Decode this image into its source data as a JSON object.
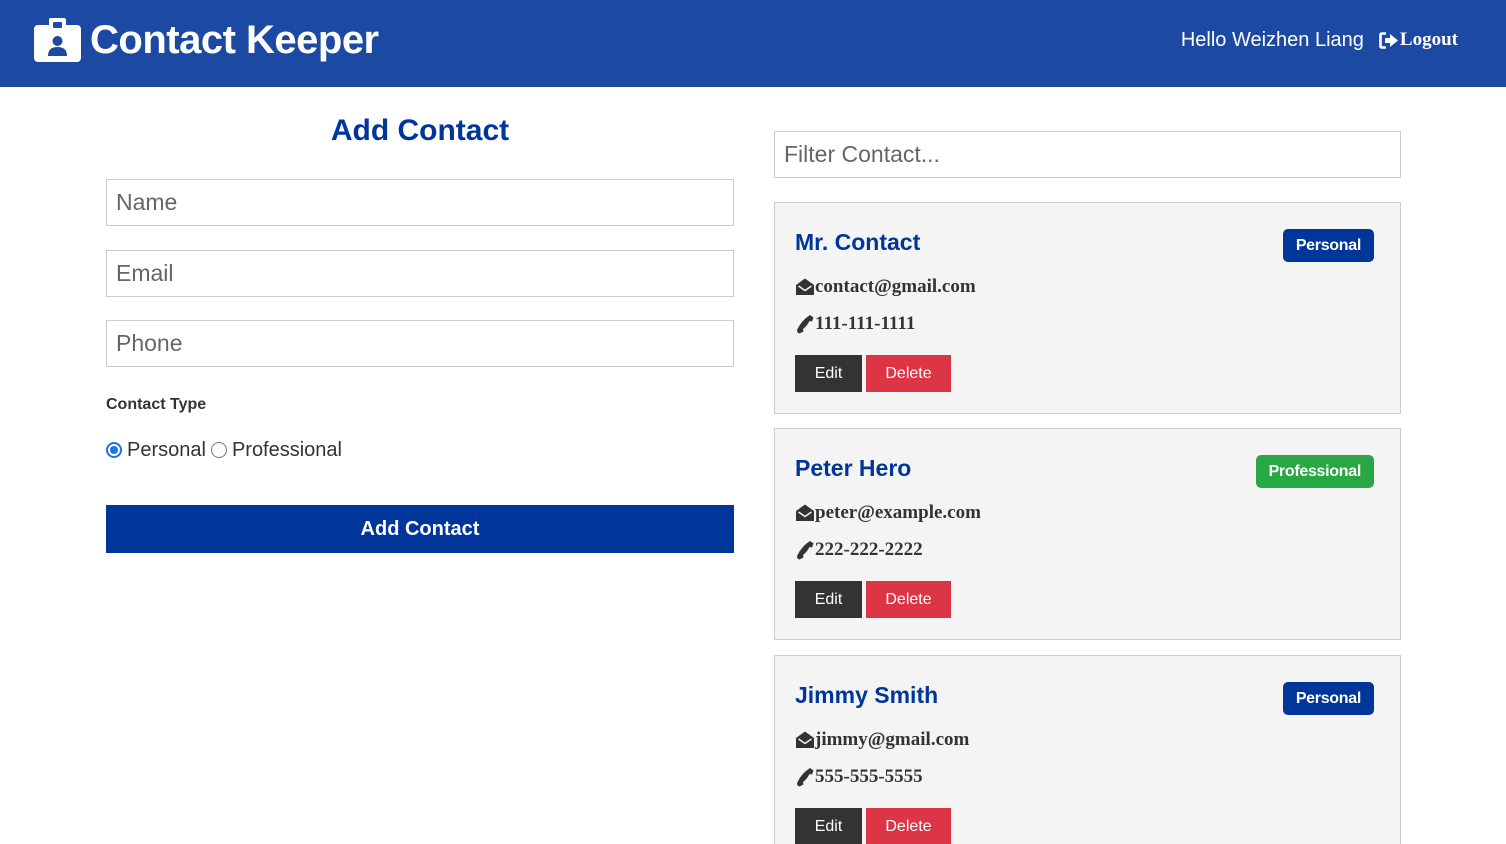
{
  "navbar": {
    "title": "Contact Keeper",
    "greeting": "Hello Weizhen Liang",
    "logout_label": "Logout",
    "background": "#1c4aa2"
  },
  "form": {
    "heading": "Add Contact",
    "name_placeholder": "Name",
    "email_placeholder": "Email",
    "phone_placeholder": "Phone",
    "type_label": "Contact Type",
    "options": [
      {
        "label": "Personal",
        "checked": true
      },
      {
        "label": "Professional",
        "checked": false
      }
    ],
    "submit_label": "Add Contact"
  },
  "filter": {
    "placeholder": "Filter Contact..."
  },
  "contacts": [
    {
      "name": "Mr. Contact",
      "type": "Personal",
      "email": "contact@gmail.com",
      "phone": "111-111-1111"
    },
    {
      "name": "Peter Hero",
      "type": "Professional",
      "email": "peter@example.com",
      "phone": "222-222-2222"
    },
    {
      "name": "Jimmy Smith",
      "type": "Personal",
      "email": "jimmy@gmail.com",
      "phone": "555-555-5555"
    }
  ],
  "card_actions": {
    "edit_label": "Edit",
    "delete_label": "Delete"
  },
  "colors": {
    "primary": "#003699",
    "success": "#28a745",
    "danger": "#dc3545",
    "dark": "#333333",
    "light": "#f4f4f4"
  },
  "icons": {
    "brand": "id-badge-icon",
    "logout": "sign-out-icon",
    "email": "envelope-open-icon",
    "phone": "phone-icon"
  }
}
